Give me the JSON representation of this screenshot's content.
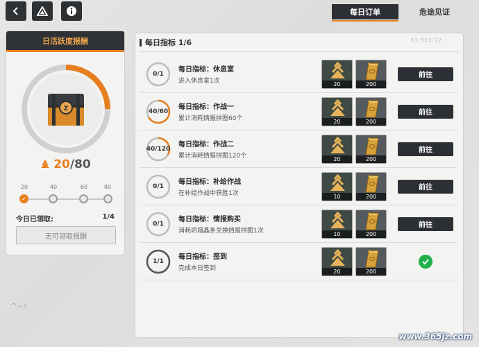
{
  "tabs": [
    {
      "label": "每日订单",
      "active": true
    },
    {
      "label": "危途见证",
      "active": false
    }
  ],
  "left": {
    "title": "日活跃度报酬",
    "score_current": "20",
    "score_total": "/80",
    "progress_fraction": 0.25,
    "milestones": [
      "20",
      "40",
      "60",
      "80"
    ],
    "claimed_label": "今日已领取:",
    "claimed_value": "1/4",
    "claim_button": "无可领取报酬"
  },
  "panel": {
    "header": "每日指标 1/6",
    "stamp": "81-515-22"
  },
  "tasks": [
    {
      "progress_text": "0/1",
      "fraction": 0,
      "title": "每日指标：休息室",
      "desc": "进入休息室1次",
      "reward_crystal": "20",
      "reward_gold": "200",
      "action": "前往",
      "completed": false
    },
    {
      "progress_text": "40/60",
      "fraction": 0.667,
      "title": "每日指标：作战一",
      "desc": "累计消耗情报拼图60个",
      "reward_crystal": "20",
      "reward_gold": "200",
      "action": "前往",
      "completed": false
    },
    {
      "progress_text": "40/120",
      "fraction": 0.333,
      "title": "每日指标：作战二",
      "desc": "累计消耗情报拼图120个",
      "reward_crystal": "20",
      "reward_gold": "200",
      "action": "前往",
      "completed": false
    },
    {
      "progress_text": "0/1",
      "fraction": 0,
      "title": "每日指标：补给作战",
      "desc": "在补给作战中获胜1次",
      "reward_crystal": "10",
      "reward_gold": "200",
      "action": "前往",
      "completed": false
    },
    {
      "progress_text": "0/1",
      "fraction": 0,
      "title": "每日指标：情报购买",
      "desc": "消耗坍塌晶条兑换情报拼图1次",
      "reward_crystal": "10",
      "reward_gold": "200",
      "action": "前往",
      "completed": false
    },
    {
      "progress_text": "1/1",
      "fraction": 1,
      "title": "每日指标：签到",
      "desc": "完成本日签到",
      "reward_crystal": "20",
      "reward_gold": "200",
      "action": "",
      "completed": true
    }
  ],
  "colors": {
    "accent": "#e87f1e",
    "dark": "#2c2f33",
    "success": "#23b04c"
  },
  "icons": {
    "back": "chevron-left-icon",
    "drive": "triangle-logo-icon",
    "info": "info-icon"
  },
  "watermark": "www.365jz.com"
}
